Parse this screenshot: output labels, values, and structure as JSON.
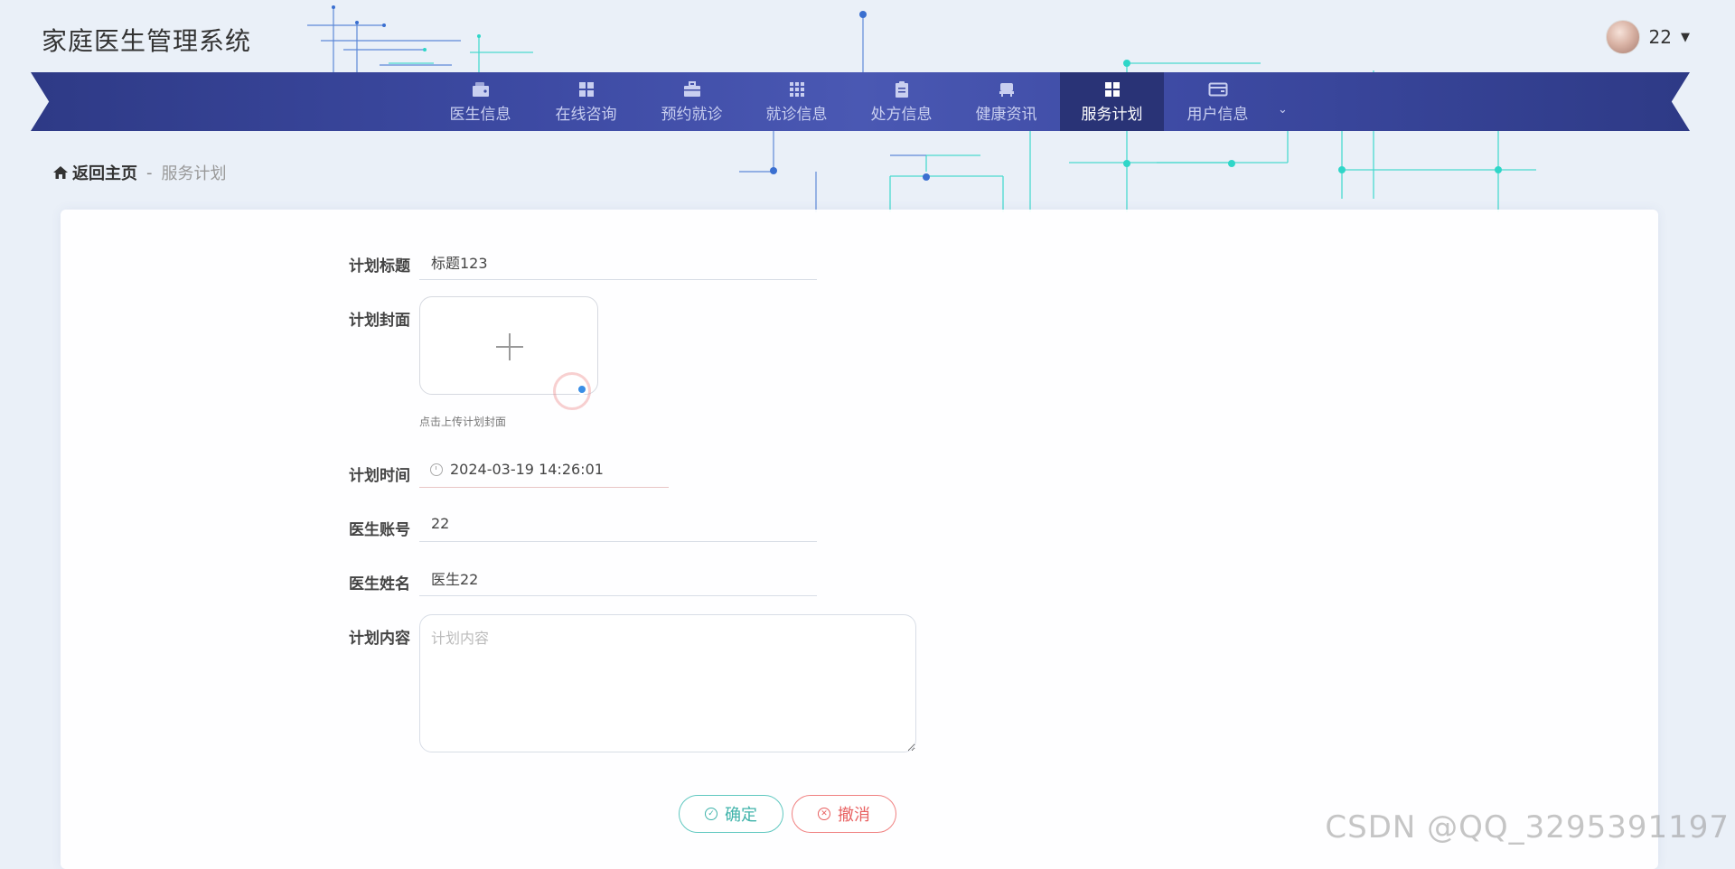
{
  "app": {
    "title": "家庭医生管理系统"
  },
  "user": {
    "name": "22"
  },
  "nav": {
    "items": [
      {
        "label": "医生信息",
        "icon": "wallet-icon"
      },
      {
        "label": "在线咨询",
        "icon": "grid-icon"
      },
      {
        "label": "预约就诊",
        "icon": "briefcase-icon"
      },
      {
        "label": "就诊信息",
        "icon": "apps-grid-icon"
      },
      {
        "label": "处方信息",
        "icon": "clipboard-icon"
      },
      {
        "label": "健康资讯",
        "icon": "bed-icon"
      },
      {
        "label": "服务计划",
        "icon": "grid-icon",
        "active": true
      },
      {
        "label": "用户信息",
        "icon": "card-icon",
        "has_dropdown": true
      }
    ]
  },
  "breadcrumb": {
    "home": "返回主页",
    "separator": "-",
    "current": "服务计划"
  },
  "form": {
    "title_label": "计划标题",
    "title_value": "标题123",
    "cover_label": "计划封面",
    "cover_tip": "点击上传计划封面",
    "time_label": "计划时间",
    "time_value": "2024-03-19 14:26:01",
    "account_label": "医生账号",
    "account_value": "22",
    "name_label": "医生姓名",
    "name_value": "医生22",
    "content_label": "计划内容",
    "content_placeholder": "计划内容"
  },
  "buttons": {
    "confirm": "确定",
    "cancel": "撤消"
  },
  "watermark": "CSDN @QQ_3295391197",
  "colors": {
    "nav_bg": "#3d4aa3",
    "nav_active": "#293376",
    "confirm": "#3fb3aa",
    "cancel": "#e86060",
    "accent_cyan": "#2fd6c8"
  }
}
